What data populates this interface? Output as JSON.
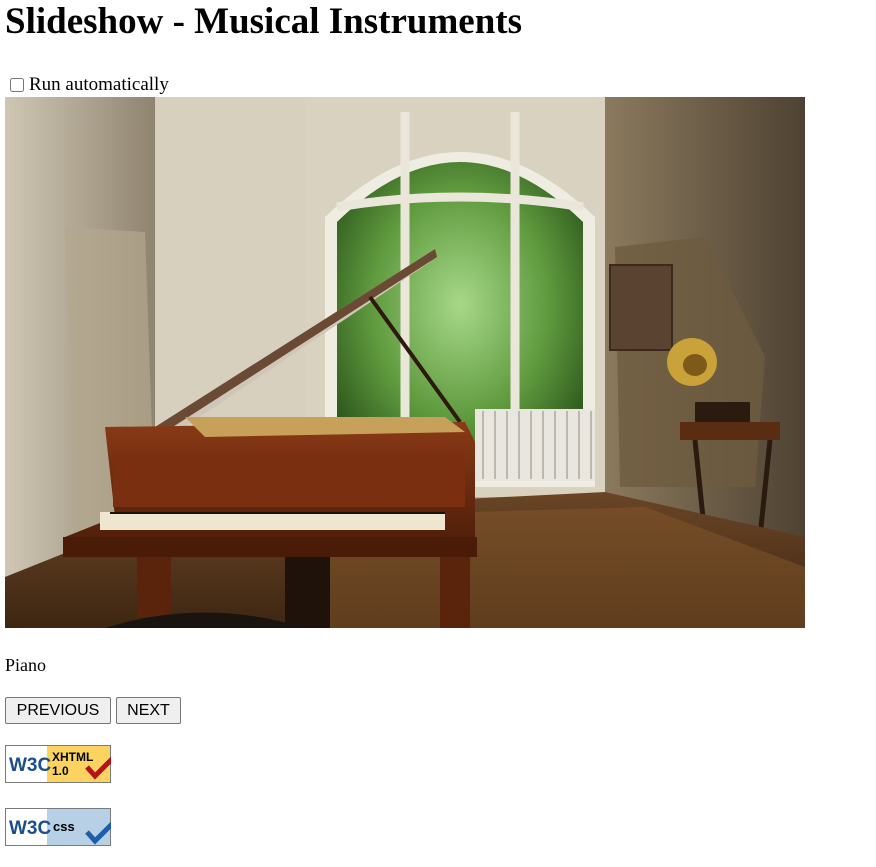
{
  "page": {
    "title": "Slideshow - Musical Instruments"
  },
  "controls": {
    "auto_label": "Run automatically",
    "auto_checked": false,
    "previous_label": "PREVIOUS",
    "next_label": "NEXT"
  },
  "slide": {
    "caption": "Piano",
    "image_subject": "grand piano in an old room with arched window"
  },
  "badges": [
    {
      "logo": "W3C",
      "label": "XHTML",
      "version": "1.0",
      "check_color": "#b5121b",
      "bg": "#fcd360"
    },
    {
      "logo": "W3C",
      "label": "css",
      "check_color": "#1d5ea8",
      "bg": "#b8d0e6"
    }
  ],
  "colors": {
    "w3c_blue": "#1a4f8b",
    "button_bg": "#efefef"
  }
}
